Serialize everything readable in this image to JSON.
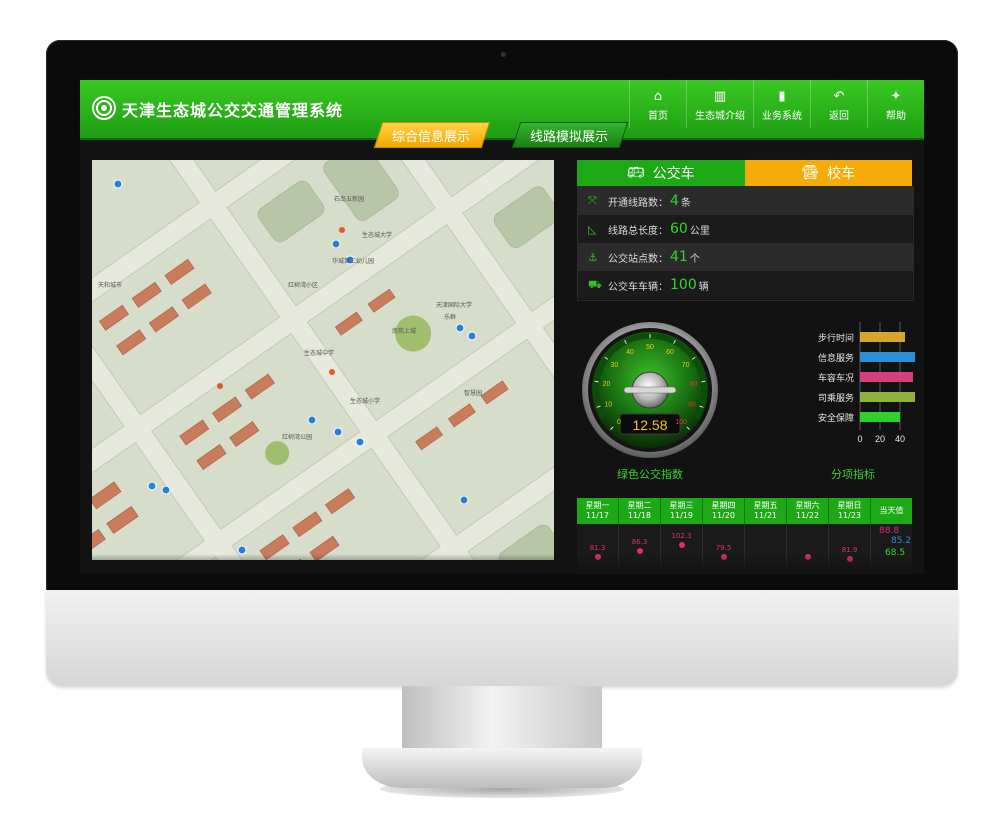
{
  "app": {
    "title": "天津生态城公交交通管理系统"
  },
  "nav": [
    {
      "label": "首页",
      "icon": "home-icon",
      "glyph": "⌂"
    },
    {
      "label": "生态城介绍",
      "icon": "map-icon",
      "glyph": "▥"
    },
    {
      "label": "业务系统",
      "icon": "bar-chart-icon",
      "glyph": "▮"
    },
    {
      "label": "返回",
      "icon": "back-icon",
      "glyph": "↶"
    },
    {
      "label": "帮助",
      "icon": "help-icon",
      "glyph": "✦"
    }
  ],
  "tabs": {
    "overview": "综合信息展示",
    "route_sim": "线路模拟展示"
  },
  "bus_tabs": {
    "bus": "公交车",
    "school": "校车"
  },
  "stats": [
    {
      "label": "开通线路数：",
      "value": "4",
      "unit": "条",
      "icon": "expand-icon",
      "glyph": "⤧"
    },
    {
      "label": "线路总长度：",
      "value": "60",
      "unit": "公里",
      "icon": "ruler-icon",
      "glyph": "◺"
    },
    {
      "label": "公交站点数：",
      "value": "41",
      "unit": "个",
      "icon": "anchor-icon",
      "glyph": "⚓"
    },
    {
      "label": "公交车车辆：",
      "value": "100",
      "unit": "辆",
      "icon": "bus-icon",
      "glyph": "⛟"
    }
  ],
  "gauge": {
    "value": "12.58",
    "caption": "绿色公交指数",
    "ticks": [
      "0",
      "10",
      "20",
      "30",
      "40",
      "50",
      "60",
      "70",
      "80",
      "90",
      "100"
    ]
  },
  "chart_data": {
    "type": "bar",
    "orientation": "horizontal",
    "categories": [
      "步行时间",
      "信息服务",
      "车容车况",
      "司乘服务",
      "安全保障"
    ],
    "values": [
      45,
      76,
      53,
      90,
      40
    ],
    "colors": [
      "#d4a62a",
      "#2a8fd6",
      "#d6407e",
      "#8fb33a",
      "#2ed02a"
    ],
    "xlim": [
      0,
      100
    ],
    "xticks": [
      "0",
      "20",
      "40",
      "60",
      "80",
      "100"
    ],
    "title": "分项指标"
  },
  "week": {
    "days": [
      {
        "day": "星期一",
        "date": "11/17",
        "value": "81.3"
      },
      {
        "day": "星期二",
        "date": "11/18",
        "value": "86.3"
      },
      {
        "day": "星期三",
        "date": "11/19",
        "value": "102.3"
      },
      {
        "day": "星期四",
        "date": "11/20",
        "value": "79.5"
      },
      {
        "day": "星期五",
        "date": "11/21",
        "value": ""
      },
      {
        "day": "星期六",
        "date": "11/22",
        "value": ""
      },
      {
        "day": "星期日",
        "date": "11/23",
        "value": "81.9"
      }
    ],
    "today_label": "当天值",
    "today_values": [
      "88.8",
      "85.2",
      "68.5"
    ]
  },
  "map": {
    "labels": [
      "石岛五新园",
      "生态城大学",
      "华城第二幼儿园",
      "天和城市",
      "红树湾小区",
      "南苑上城",
      "生态城中学",
      "乐群",
      "天津国际大学",
      "生态城小学",
      "红树湾公园",
      "智慧园"
    ]
  }
}
